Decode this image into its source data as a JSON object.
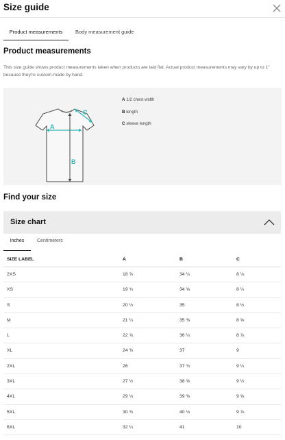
{
  "header": {
    "title": "Size guide"
  },
  "tabs": [
    {
      "label": "Product measurements",
      "active": true
    },
    {
      "label": "Body measurement guide",
      "active": false
    }
  ],
  "product": {
    "heading": "Product measurements",
    "description": "This size guide shows product measurements taken when products are laid flat. Actual product measurements may vary by up to 1\" because they're custom-made by hand.",
    "legend": [
      {
        "key": "A",
        "text": "1/2 chest width"
      },
      {
        "key": "B",
        "text": "length"
      },
      {
        "key": "C",
        "text": "sleeve length"
      }
    ],
    "diagram_labels": {
      "a": "A",
      "b": "B",
      "c": "C"
    }
  },
  "find": {
    "heading": "Find your size"
  },
  "size_chart": {
    "title": "Size chart",
    "units": [
      {
        "label": "Inches",
        "active": true
      },
      {
        "label": "Centimeters",
        "active": false
      }
    ],
    "columns": [
      "SIZE LABEL",
      "A",
      "B",
      "C"
    ],
    "rows": [
      [
        "2XS",
        "18 ⅞",
        "34 ¼",
        "8 ⅛"
      ],
      [
        "XS",
        "19 ¾",
        "34 ⅝",
        "8 ¼"
      ],
      [
        "S",
        "20 ½",
        "35",
        "8 ½"
      ],
      [
        "M",
        "21 ¼",
        "35 ⅜",
        "8 ⅝"
      ],
      [
        "L",
        "22 ⅞",
        "36 ¼",
        "8 ⅞"
      ],
      [
        "XL",
        "24 ⅜",
        "37",
        "9"
      ],
      [
        "2XL",
        "26",
        "37 ¾",
        "9 ¼"
      ],
      [
        "3XL",
        "27 ½",
        "38 ⅝",
        "9 ½"
      ],
      [
        "4XL",
        "29 ⅛",
        "39 ⅜",
        "9 ⅝"
      ],
      [
        "5XL",
        "30 ¾",
        "40 ⅛",
        "9 ⅞"
      ],
      [
        "6XL",
        "32 ¼",
        "41",
        "10"
      ]
    ]
  },
  "colors": {
    "accent": "#2fb5b5",
    "panel": "#f3f3f3",
    "chart_header": "#ececec"
  }
}
